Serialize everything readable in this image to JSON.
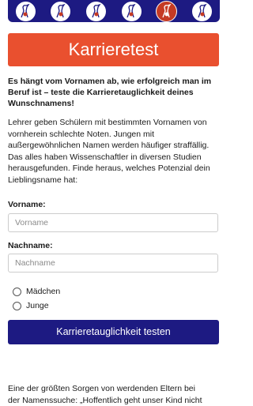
{
  "icon_strip": {
    "icons": [
      "stork-icon",
      "stork-icon",
      "stork-icon",
      "stork-icon",
      "stork-icon",
      "stork-icon"
    ],
    "selected_index": 4,
    "brand_color": "#1d1a82",
    "accent_color": "#c53a24"
  },
  "banner": {
    "title": "Karrieretest",
    "color": "#e9502f"
  },
  "lead": "Es hängt vom Vornamen ab, wie erfolgreich man im Beruf ist – teste die Karrieretauglichkeit deines Wunschnamens!",
  "intro": "Lehrer geben Schülern mit bestimmten Vornamen von vornherein schlechte Noten. Jungen mit außergewöhnlichen Namen werden häufiger straffällig. Das alles haben Wissenschaftler in diversen Studien herausgefunden. Finde heraus, welches Potenzial dein Lieblingsname hat:",
  "form": {
    "firstname_label": "Vorname:",
    "firstname_placeholder": "Vorname",
    "firstname_value": "",
    "lastname_label": "Nachname:",
    "lastname_placeholder": "Nachname",
    "lastname_value": "",
    "gender_options": [
      "Mädchen",
      "Junge"
    ],
    "gender_selected": null,
    "submit_label": "Karrieretauglichkeit testen"
  },
  "article": {
    "line1": "Eine der größten Sorgen von werdenden Eltern bei",
    "line2": "der Namenssuche: „Hoffentlich geht unser Kind nicht"
  }
}
